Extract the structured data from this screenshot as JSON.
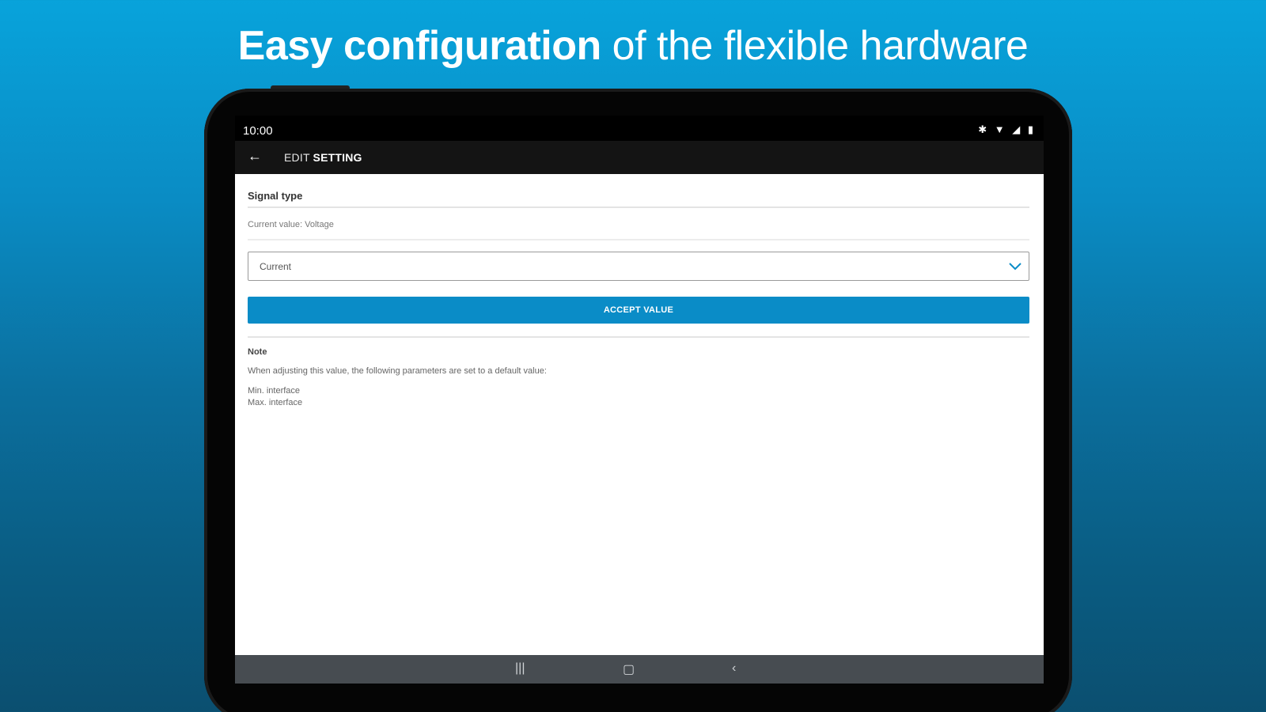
{
  "headline": {
    "bold": "Easy configuration",
    "rest": " of the flexible hardware"
  },
  "status_bar": {
    "time": "10:00",
    "icons": [
      "bluetooth-icon",
      "wifi-icon",
      "signal-icon",
      "battery-icon"
    ]
  },
  "app_bar": {
    "title_prefix": "EDIT ",
    "title_bold": "SETTING"
  },
  "setting": {
    "title": "Signal type",
    "current_value": "Current value: Voltage",
    "selected_option": "Current",
    "accept_label": "ACCEPT VALUE"
  },
  "note": {
    "heading": "Note",
    "text": "When adjusting this value, the following parameters are set to a default value:",
    "params": [
      "Min. interface",
      "Max. interface"
    ]
  },
  "nav_bar": {
    "recents": "recents-icon",
    "home": "home-icon",
    "back": "back-icon"
  },
  "colors": {
    "accent": "#0a8cc7",
    "appbar": "#141414",
    "navbar": "#474c51"
  }
}
